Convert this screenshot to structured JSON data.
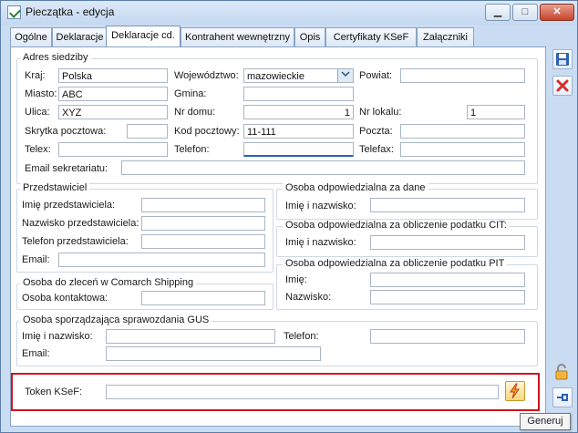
{
  "window": {
    "title": "Pieczątka - edycja",
    "buttons": {
      "minimize": "▁",
      "maximize": "□",
      "close": "✕"
    }
  },
  "tabs": [
    "Ogólne",
    "Deklaracje",
    "Deklaracje cd.",
    "Kontrahent wewnętrzny",
    "Opis",
    "Certyfikaty KSeF",
    "Załączniki"
  ],
  "address": {
    "group_label": "Adres siedziby",
    "kraj_label": "Kraj:",
    "kraj_value": "Polska",
    "woj_label": "Województwo:",
    "woj_value": "mazowieckie",
    "powiat_label": "Powiat:",
    "powiat_value": "",
    "miasto_label": "Miasto:",
    "miasto_value": "ABC",
    "gmina_label": "Gmina:",
    "gmina_value": "",
    "ulica_label": "Ulica:",
    "ulica_value": "XYZ",
    "nr_domu_label": "Nr domu:",
    "nr_domu_value": "1",
    "nr_lokalu_label": "Nr lokalu:",
    "nr_lokalu_value": "1",
    "skrytka_label": "Skrytka pocztowa:",
    "skrytka_value": "",
    "kod_label": "Kod pocztowy:",
    "kod_value": "11-111",
    "poczta_label": "Poczta:",
    "poczta_value": "",
    "telex_label": "Telex:",
    "telex_value": "",
    "telefon_label": "Telefon:",
    "telefon_value": "",
    "telefax_label": "Telefax:",
    "telefax_value": "",
    "email_label": "Email sekretariatu:",
    "email_value": ""
  },
  "przedstawiciel": {
    "group_label": "Przedstawiciel",
    "imie_label": "Imię przedstawiciela:",
    "nazwisko_label": "Nazwisko przedstawiciela:",
    "telefon_label": "Telefon przedstawiciela:",
    "email_label": "Email:"
  },
  "osoba_dane": {
    "group_label": "Osoba odpowiedzialna za dane",
    "imie_label": "Imię i nazwisko:"
  },
  "osoba_cit": {
    "group_label": "Osoba odpowiedzialna za obliczenie podatku CIT:",
    "imie_label": "Imię i nazwisko:"
  },
  "osoba_pit": {
    "group_label": "Osoba odpowiedzialna za obliczenie podatku PIT",
    "imie_label": "Imię:",
    "nazwisko_label": "Nazwisko:"
  },
  "shipping": {
    "group_label": "Osoba do zleceń w Comarch Shipping",
    "kontakt_label": "Osoba kontaktowa:"
  },
  "gus": {
    "group_label": "Osoba sporządzająca sprawozdania GUS",
    "imie_label": "Imię i nazwisko:",
    "telefon_label": "Telefon:",
    "email_label": "Email:"
  },
  "token": {
    "label": "Token KSeF:",
    "value": "",
    "button_icon": "lightning-icon"
  },
  "tooltip": "Generuj",
  "icons": {
    "save": "save-icon",
    "delete": "delete-icon",
    "lock": "lock-icon",
    "pin": "pin-icon"
  },
  "colors": {
    "highlight": "#d0141c",
    "frame": "#c9dcf2"
  }
}
